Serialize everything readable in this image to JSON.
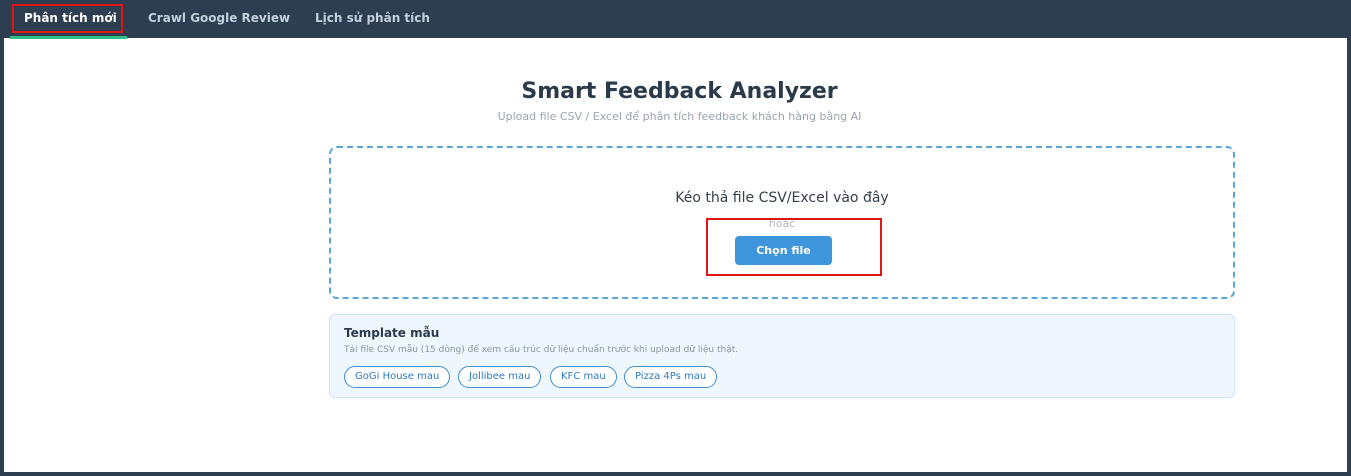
{
  "nav": {
    "tabs": [
      {
        "label": "Phân tích mới",
        "active": true
      },
      {
        "label": "Crawl Google Review",
        "active": false
      },
      {
        "label": "Lịch sử phân tích",
        "active": false
      }
    ]
  },
  "header": {
    "title": "Smart Feedback Analyzer",
    "subtitle": "Upload file CSV / Excel để phân tích feedback khách hàng bằng AI"
  },
  "dropzone": {
    "main_text": "Kéo thả file CSV/Excel vào đây",
    "or_text": "hoặc",
    "button_label": "Chọn file"
  },
  "templates": {
    "title": "Template mẫu",
    "description": "Tải file CSV mẫu (15 dòng) để xem cấu trúc dữ liệu chuẩn trước khi upload dữ liệu thật.",
    "items": [
      {
        "label": "GoGi House mau"
      },
      {
        "label": "Jollibee mau"
      },
      {
        "label": "KFC mau"
      },
      {
        "label": "Pizza 4Ps mau"
      }
    ]
  },
  "colors": {
    "navbar": "#2d3e50",
    "accent": "#3f95dc",
    "active_underline": "#2fc08a",
    "annotation": "#e01616"
  }
}
